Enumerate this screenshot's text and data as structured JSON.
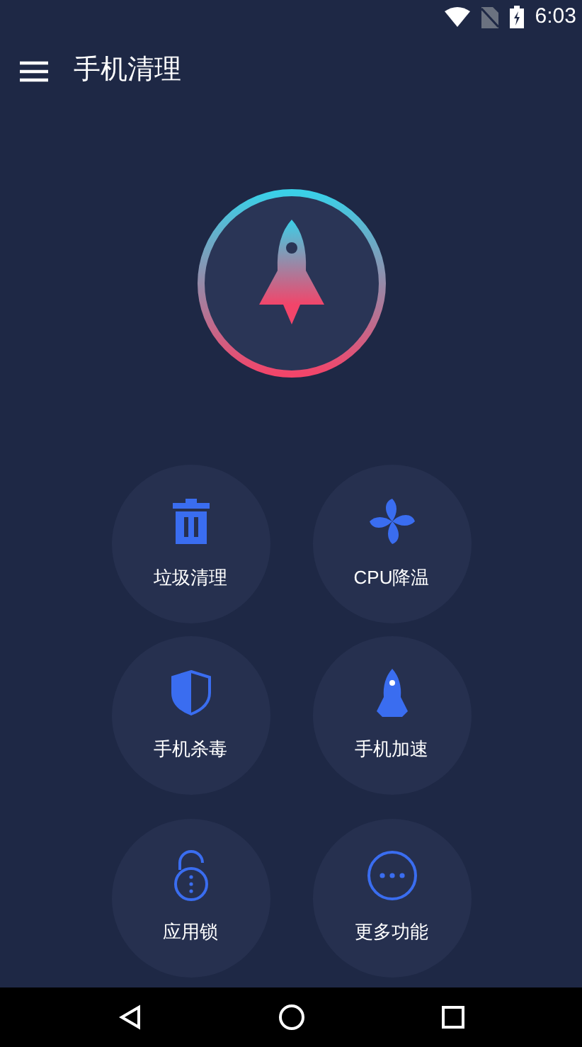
{
  "status_bar": {
    "time": "6:03"
  },
  "app_bar": {
    "title": "手机清理"
  },
  "tools": [
    {
      "kind": "trash",
      "label": "垃圾清理"
    },
    {
      "kind": "fan",
      "label": "CPU降温"
    },
    {
      "kind": "shield",
      "label": "手机杀毒"
    },
    {
      "kind": "rocket",
      "label": "手机加速"
    },
    {
      "kind": "lock",
      "label": "应用锁"
    },
    {
      "kind": "more",
      "label": "更多功能"
    }
  ]
}
